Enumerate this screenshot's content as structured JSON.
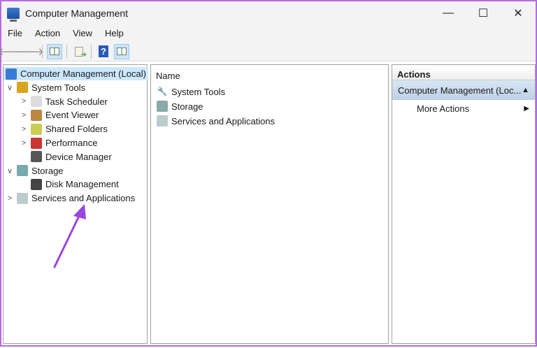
{
  "window": {
    "title": "Computer Management",
    "minimize": "—",
    "maximize": "☐",
    "close": "✕"
  },
  "menu": [
    "File",
    "Action",
    "View",
    "Help"
  ],
  "toolbar": {
    "back": "🡐",
    "forward": "🡒",
    "help": "?"
  },
  "tree": [
    {
      "label": "Computer Management (Local)",
      "level": 0,
      "expander": "",
      "selected": true
    },
    {
      "label": "System Tools",
      "level": 1,
      "expander": "∨"
    },
    {
      "label": "Task Scheduler",
      "level": 2,
      "expander": ">"
    },
    {
      "label": "Event Viewer",
      "level": 2,
      "expander": ">"
    },
    {
      "label": "Shared Folders",
      "level": 2,
      "expander": ">"
    },
    {
      "label": "Performance",
      "level": 2,
      "expander": ">"
    },
    {
      "label": "Device Manager",
      "level": 2,
      "expander": ""
    },
    {
      "label": "Storage",
      "level": 1,
      "expander": "∨"
    },
    {
      "label": "Disk Management",
      "level": 2,
      "expander": ""
    },
    {
      "label": "Services and Applications",
      "level": 1,
      "expander": ">"
    }
  ],
  "list": {
    "header": "Name",
    "items": [
      "System Tools",
      "Storage",
      "Services and Applications"
    ]
  },
  "actions": {
    "header": "Actions",
    "section": "Computer Management (Loc...",
    "section_icon": "▲",
    "items": [
      {
        "label": "More Actions",
        "icon": "▶"
      }
    ]
  },
  "colors": {
    "annotation": "#9b45e0",
    "selection": "#cce8ff"
  }
}
